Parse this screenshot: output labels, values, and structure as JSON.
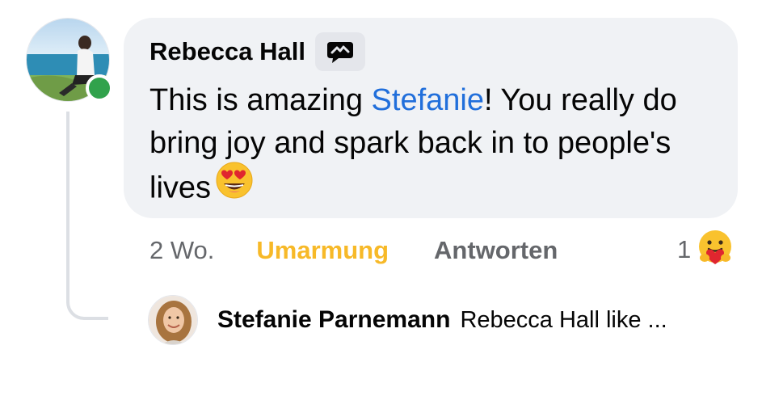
{
  "comment": {
    "author": "Rebecca Hall",
    "badge_icon": "top-fan-chat-icon",
    "text_before": "This is amazing ",
    "mention": "Stefanie",
    "text_after": "! You really do bring joy and spark back in to people's lives",
    "emoji": "heart-eyes-emoji",
    "online": true,
    "online_color": "#31a24c",
    "mention_color": "#216fdb",
    "bubble_color": "#f0f2f5"
  },
  "actions": {
    "time": "2 Wo.",
    "reaction_label": "Umarmung",
    "reaction_label_color": "#f7b928",
    "reply_label": "Antworten",
    "reaction_count": "1",
    "reaction_icon": "care-hug-emoji"
  },
  "reply_preview": {
    "author": "Stefanie Parnemann",
    "snippet": "Rebecca Hall like ..."
  }
}
